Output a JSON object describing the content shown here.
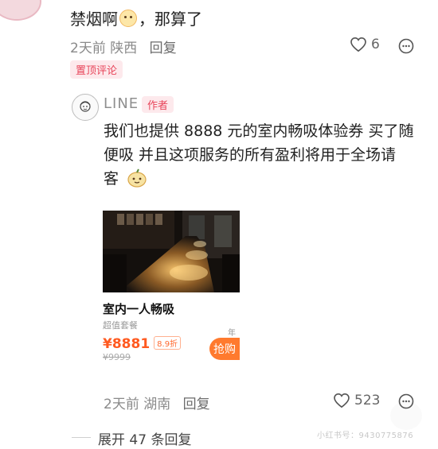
{
  "comment": {
    "text_before_emoji": "禁烟啊",
    "text_after_emoji": "，那算了",
    "emoji": "crying-face-icon",
    "time": "2天前",
    "location": "陕西",
    "reply_label": "回复",
    "likes": "6",
    "pinned_label": "置顶评论"
  },
  "reply": {
    "author": "LINE",
    "author_badge": "作者",
    "lines": [
      "我们也提供 8888 元的室内畅吸体验券  买了随",
      "便吸 并且这项服务的所有盈利将用于全场请",
      "客"
    ],
    "emoji": "pear-face-icon",
    "time": "2天前",
    "location": "湖南",
    "reply_label": "回复",
    "likes": "523"
  },
  "product_card": {
    "title": "室内一人畅吸",
    "subtitle": "超值套餐",
    "price": "¥8881",
    "discount": "8.9折",
    "original_price": "¥9999",
    "year_tag": "年",
    "buy_label": "抢购"
  },
  "footer": {
    "expand_label": "展开 47 条回复",
    "watermark": "小红书号：9430775876"
  },
  "colors": {
    "accent": "#e8455a",
    "price": "#ff5a20",
    "buy_button": "#ff7a2e"
  }
}
